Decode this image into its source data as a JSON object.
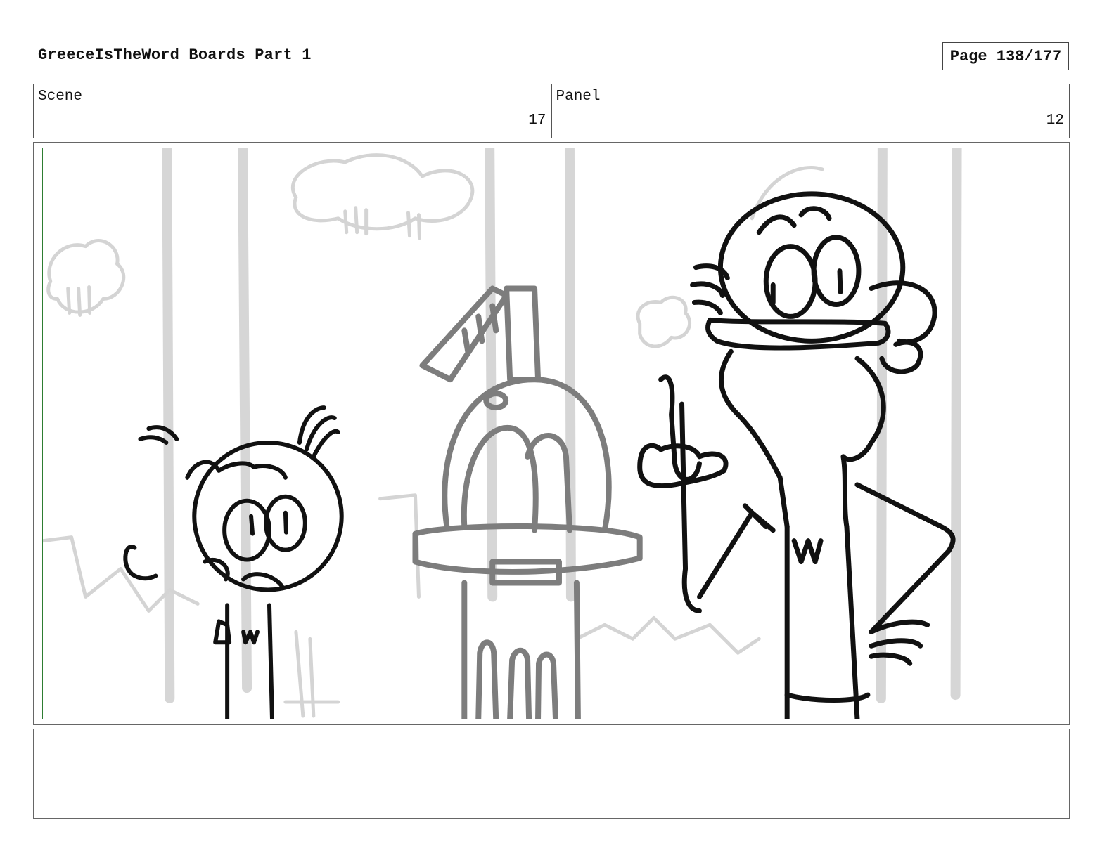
{
  "header": {
    "title": "GreeceIsTheWord Boards Part 1",
    "page": "Page 138/177"
  },
  "info": {
    "scene_label": "Scene",
    "scene_value": "17",
    "panel_label": "Panel",
    "panel_value": "12"
  },
  "panel": {
    "sketch_colors": {
      "ink": "#111111",
      "mid": "#7a7a7a",
      "bg": "#d4d4d4",
      "frame": "#2e7d32"
    }
  },
  "notes": {
    "text": ""
  }
}
